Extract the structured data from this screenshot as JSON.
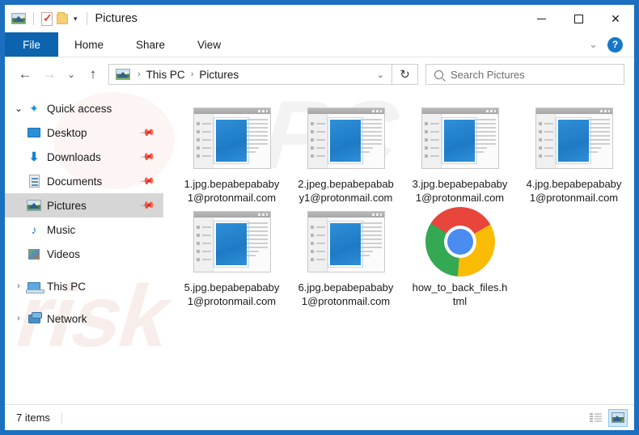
{
  "window": {
    "title": "Pictures",
    "qat": [
      {
        "name": "pictures-folder-icon",
        "label": "Pictures"
      },
      {
        "name": "properties-icon",
        "label": "Properties"
      },
      {
        "name": "new-folder-icon",
        "label": "New folder"
      },
      {
        "name": "customize-caret-icon",
        "label": "▾"
      }
    ],
    "controls": {
      "minimize": "—",
      "maximize": "□",
      "close": "✕",
      "collapse_ribbon": "⌄",
      "help": "?"
    }
  },
  "ribbon": {
    "file_label": "File",
    "tabs": [
      {
        "label": "Home"
      },
      {
        "label": "Share"
      },
      {
        "label": "View"
      }
    ]
  },
  "navigation": {
    "back": "←",
    "forward": "→",
    "recent": "⌄",
    "up": "↑",
    "refresh": "↻",
    "address_caret": "⌄",
    "breadcrumb": [
      {
        "label": "This PC"
      },
      {
        "label": "Pictures"
      }
    ],
    "breadcrumb_separator": "›"
  },
  "search": {
    "placeholder": "Search Pictures",
    "value": ""
  },
  "sidebar": {
    "items": [
      {
        "label": "Quick access",
        "icon": "star-icon",
        "arrow": "⌄",
        "expanded": true,
        "pinned": false,
        "selected": false,
        "indent": false
      },
      {
        "label": "Desktop",
        "icon": "desktop-icon",
        "arrow": "",
        "expanded": false,
        "pinned": true,
        "selected": false,
        "indent": true
      },
      {
        "label": "Downloads",
        "icon": "downloads-icon",
        "arrow": "",
        "expanded": false,
        "pinned": true,
        "selected": false,
        "indent": true
      },
      {
        "label": "Documents",
        "icon": "documents-icon",
        "arrow": "",
        "expanded": false,
        "pinned": true,
        "selected": false,
        "indent": true
      },
      {
        "label": "Pictures",
        "icon": "pictures-icon",
        "arrow": "",
        "expanded": false,
        "pinned": true,
        "selected": true,
        "indent": true
      },
      {
        "label": "Music",
        "icon": "music-icon",
        "arrow": "",
        "expanded": false,
        "pinned": false,
        "selected": false,
        "indent": true
      },
      {
        "label": "Videos",
        "icon": "videos-icon",
        "arrow": "",
        "expanded": false,
        "pinned": false,
        "selected": false,
        "indent": true
      },
      {
        "label": "This PC",
        "icon": "this-pc-icon",
        "arrow": "›",
        "expanded": false,
        "pinned": false,
        "selected": false,
        "indent": false
      },
      {
        "label": "Network",
        "icon": "network-icon",
        "arrow": "›",
        "expanded": false,
        "pinned": false,
        "selected": false,
        "indent": false
      }
    ],
    "pin_glyph": "📌"
  },
  "files": [
    {
      "name": "1.jpg.bepabepababy1@protonmail.com",
      "icon": "image-thumbnail"
    },
    {
      "name": "2.jpeg.bepabepababy1@protonmail.com",
      "icon": "image-thumbnail"
    },
    {
      "name": "3.jpg.bepabepababy1@protonmail.com",
      "icon": "image-thumbnail"
    },
    {
      "name": "4.jpg.bepabepababy1@protonmail.com",
      "icon": "image-thumbnail"
    },
    {
      "name": "5.jpg.bepabepababy1@protonmail.com",
      "icon": "image-thumbnail"
    },
    {
      "name": "6.jpg.bepabepababy1@protonmail.com",
      "icon": "image-thumbnail"
    },
    {
      "name": "how_to_back_files.html",
      "icon": "chrome-icon"
    }
  ],
  "status": {
    "item_count": "7 items",
    "views": [
      {
        "name": "details-view-button",
        "active": false
      },
      {
        "name": "large-icons-view-button",
        "active": true
      }
    ]
  },
  "watermark": {
    "top": "PC",
    "bottom": "risk"
  },
  "colors": {
    "window_frame": "#1c6fbf",
    "file_tab": "#0b64ad",
    "selection": "#d6d6d6",
    "accent": "#1878c8"
  }
}
